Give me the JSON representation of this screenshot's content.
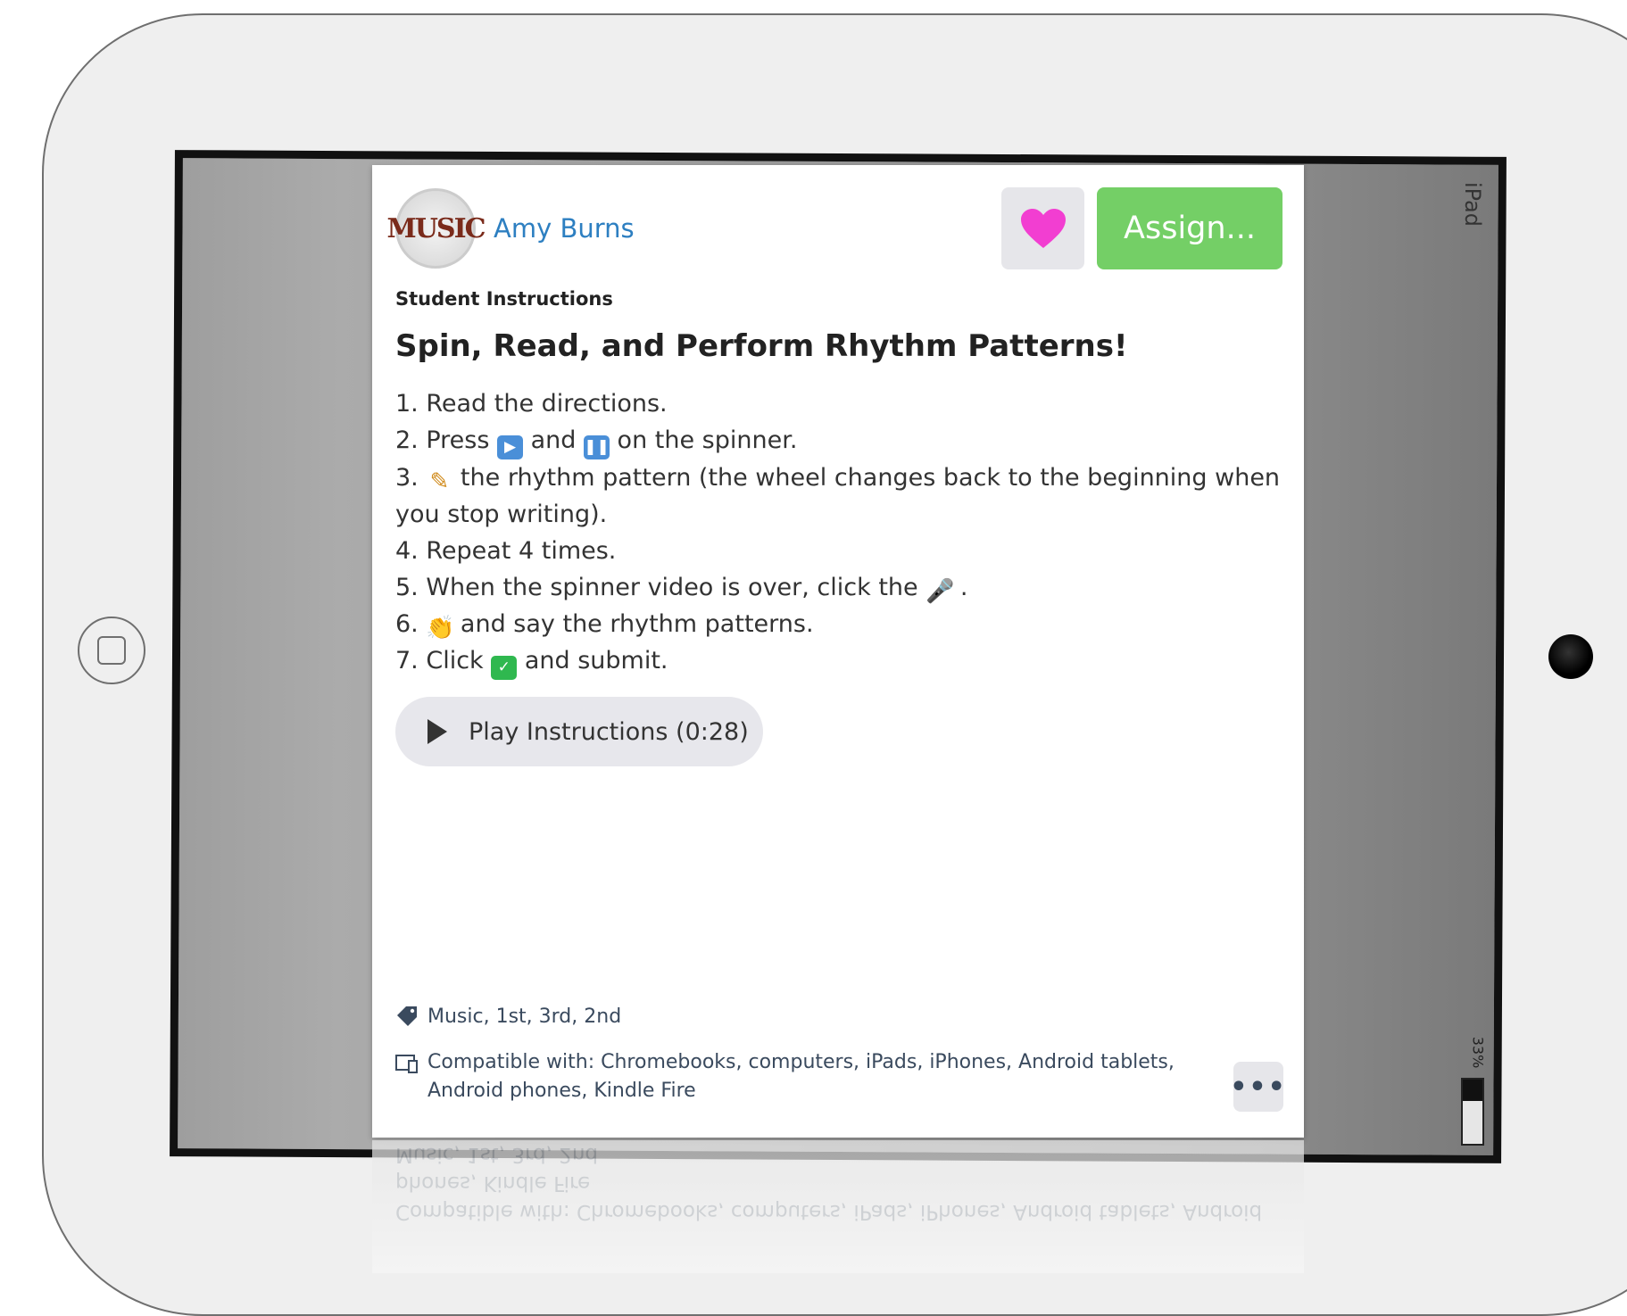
{
  "device": {
    "label": "iPad",
    "battery": "33%"
  },
  "author": {
    "name": "Amy Burns",
    "avatar_text": "MUSIC"
  },
  "actions": {
    "assign_label": "Assign...",
    "more_label": "•••"
  },
  "instructions": {
    "section_label": "Student Instructions",
    "title": "Spin, Read, and Perform Rhythm Patterns!",
    "steps": {
      "s1": "1. Read the directions.",
      "s2_a": "2. Press ",
      "s2_b": " and ",
      "s2_c": " on the spinner.",
      "s3_a": "3. ",
      "s3_b": " the rhythm pattern (the wheel changes back to the beginning when you stop writing).",
      "s4": "4. Repeat 4 times.",
      "s5_a": "5. When the spinner video is over, click the ",
      "s5_b": " .",
      "s6_a": "6. ",
      "s6_b": " and say the rhythm patterns.",
      "s7_a": "7. Click ",
      "s7_b": " and submit."
    },
    "play_label": "Play Instructions (0:28)"
  },
  "meta": {
    "tags": "Music, 1st, 3rd, 2nd",
    "compatible": "Compatible with: Chromebooks, computers, iPads, iPhones, Android tablets, Android phones, Kindle Fire"
  },
  "icons": {
    "play": "play-emoji",
    "pause": "pause-emoji",
    "pencil": "pencil-emoji",
    "mic": "microphone-emoji",
    "clap": "clapping-hands-emoji",
    "check": "check-mark-emoji"
  },
  "colors": {
    "accent_green": "#74cf66",
    "link_blue": "#2d7fc1",
    "heart_pink": "#f23ed1"
  }
}
